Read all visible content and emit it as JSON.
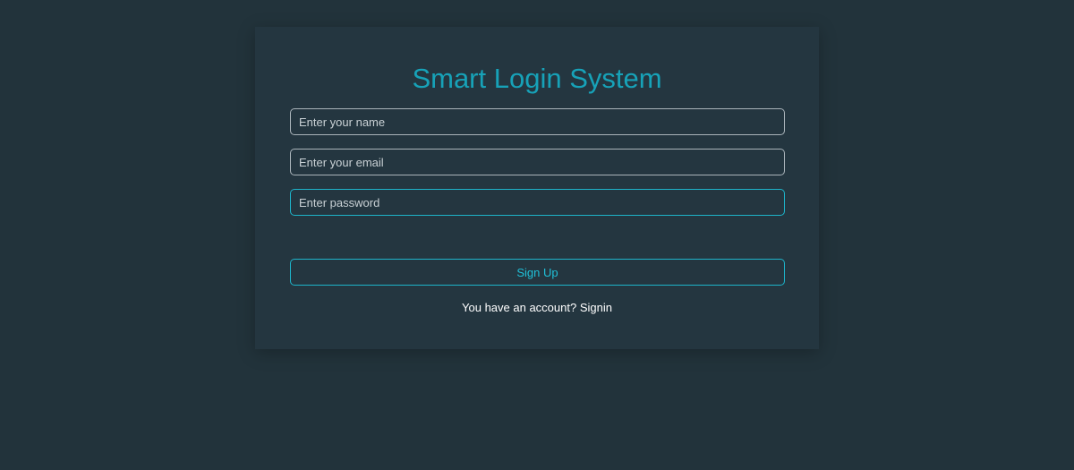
{
  "form": {
    "title": "Smart Login System",
    "name_placeholder": "Enter your name",
    "email_placeholder": "Enter your email",
    "password_placeholder": "Enter password",
    "submit_label": "Sign Up",
    "footer_text": "You have an account?",
    "footer_link": "Signin"
  },
  "colors": {
    "background": "#22333b",
    "card": "#243640",
    "accent": "#17a2b8"
  }
}
